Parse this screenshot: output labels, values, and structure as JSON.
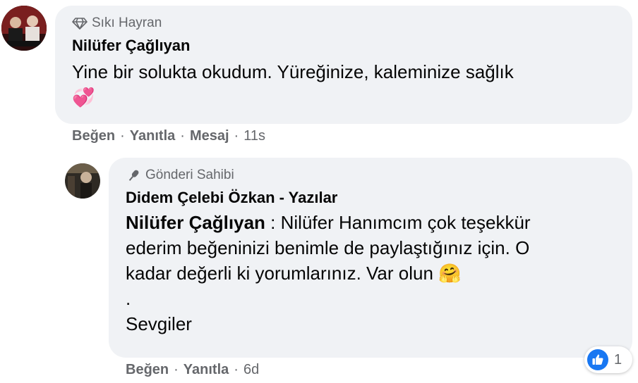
{
  "comment": {
    "badge": "Sıkı Hayran",
    "author": "Nilüfer Çağlıyan",
    "text": "Yine bir solukta okudum. Yüreğinize, kaleminize sağlık",
    "emoji": "💞",
    "actions": {
      "like": "Beğen",
      "reply": "Yanıtla",
      "message": "Mesaj",
      "time": "11s"
    }
  },
  "reply": {
    "badge": "Gönderi Sahibi",
    "author": "Didem Çelebi Özkan - Yazılar",
    "mention": "Nilüfer Çağlıyan",
    "line1_rest": " : Nilüfer Hanımcım çok teşekkür",
    "line2": "ederim beğeninizi benimle de paylaştığınız için. O",
    "line3": "kadar değerli ki yorumlarınız. Var olun",
    "emoji": "🤗",
    "line4": ".",
    "line5": "Sevgiler",
    "actions": {
      "like": "Beğen",
      "reply": "Yanıtla",
      "time": "6d"
    },
    "reaction_count": "1"
  },
  "colors": {
    "bubble": "#f0f2f5",
    "secondary": "#65676b",
    "like_blue": "#1877f2"
  }
}
